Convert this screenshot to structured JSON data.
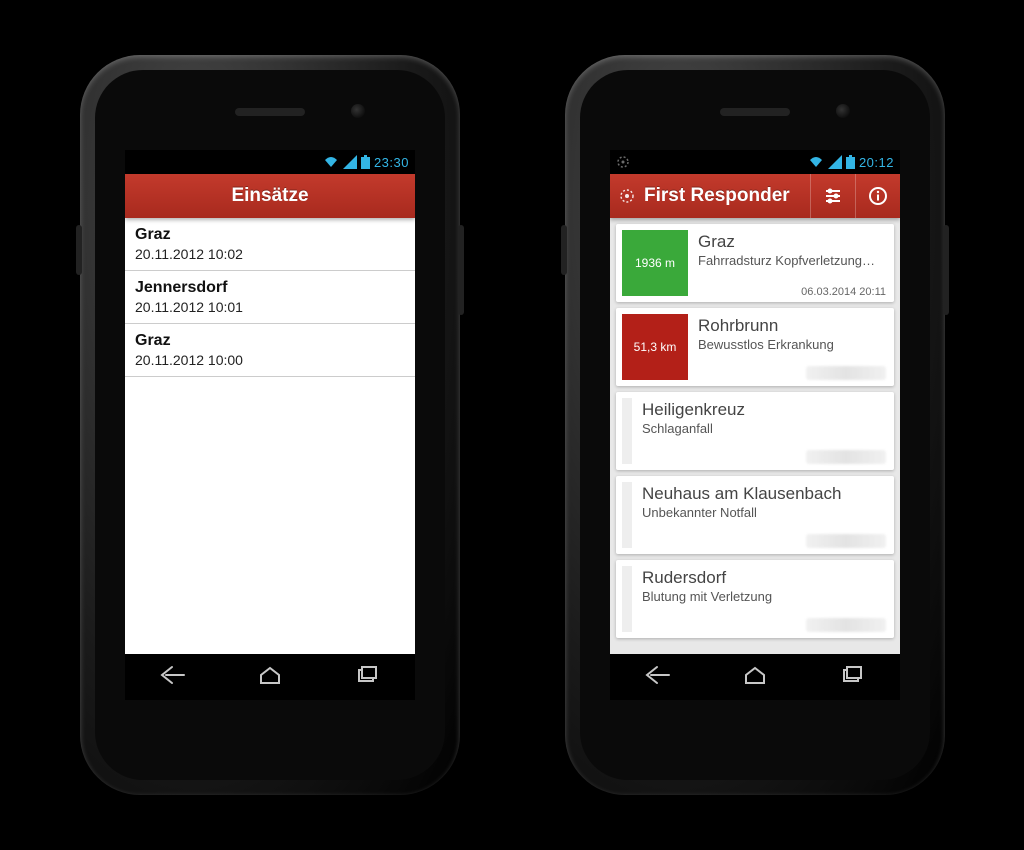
{
  "left": {
    "status_time": "23:30",
    "appbar_title": "Einsätze",
    "rows": [
      {
        "title": "Graz",
        "time": "20.11.2012 10:02"
      },
      {
        "title": "Jennersdorf",
        "time": "20.11.2012 10:01"
      },
      {
        "title": "Graz",
        "time": "20.11.2012 10:00"
      }
    ]
  },
  "right": {
    "status_time": "20:12",
    "appbar_title": "First Responder",
    "cards": [
      {
        "distance": "1936 m",
        "badge": "green",
        "location": "Graz",
        "desc": "Fahrradsturz Kopfverletzung…",
        "timestamp": "06.03.2014 20:11"
      },
      {
        "distance": "51,3 km",
        "badge": "red",
        "location": "Rohrbrunn",
        "desc": "Bewusstlos Erkrankung",
        "timestamp": ""
      },
      {
        "distance": "",
        "badge": "grey",
        "location": "Heiligenkreuz",
        "desc": "Schlaganfall",
        "timestamp": ""
      },
      {
        "distance": "",
        "badge": "grey",
        "location": "Neuhaus am Klausenbach",
        "desc": "Unbekannter Notfall",
        "timestamp": ""
      },
      {
        "distance": "",
        "badge": "grey",
        "location": "Rudersdorf",
        "desc": "Blutung mit Verletzung",
        "timestamp": ""
      }
    ]
  },
  "icons": {
    "wifi": "wifi-icon",
    "signal": "signal-icon",
    "battery": "battery-icon",
    "gps": "gps-icon",
    "settings": "sliders-icon",
    "info": "info-icon",
    "back": "back-icon",
    "home": "home-icon",
    "recent": "recent-icon"
  },
  "colors": {
    "accent": "#b32a1e",
    "status": "#33b5e5",
    "badge_green": "#3aa93a",
    "badge_red": "#b32018"
  }
}
